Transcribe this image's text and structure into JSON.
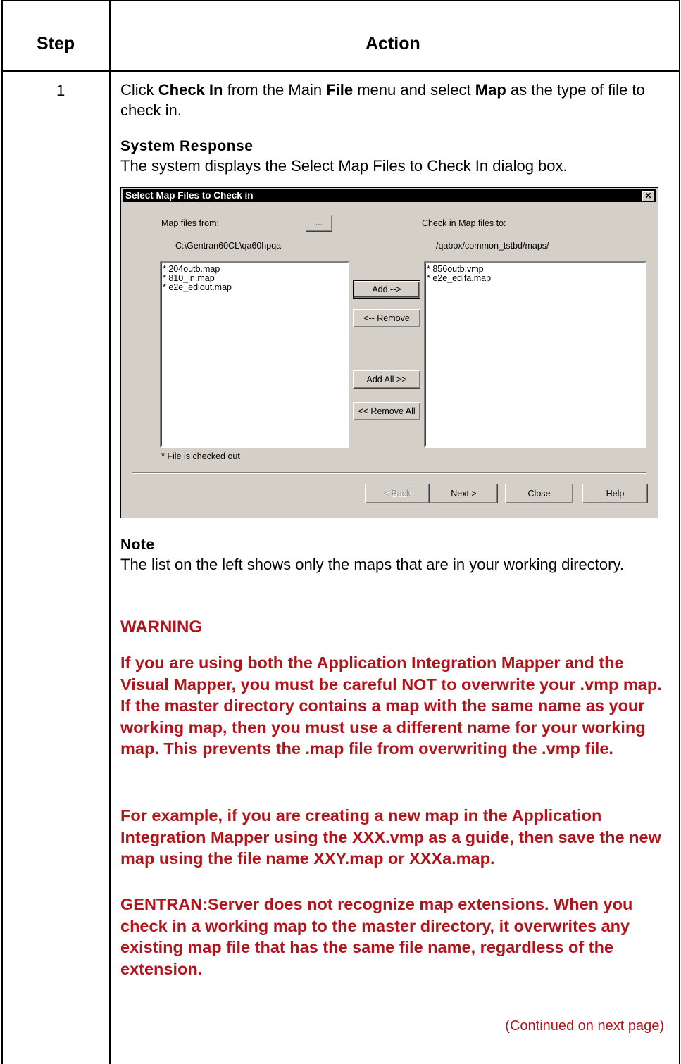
{
  "table": {
    "header_step": "Step",
    "header_action": "Action",
    "step_number": "1"
  },
  "instruction": {
    "t1": "Click ",
    "b1": "Check In",
    "t2": " from the Main ",
    "b2": "File",
    "t3": " menu and select ",
    "b3": "Map",
    "t4": " as the type of file to check in."
  },
  "system_response": {
    "heading": "System Response",
    "text": "The system displays the Select Map Files to Check In dialog box."
  },
  "dialog": {
    "title": "Select Map Files to Check in",
    "close_glyph": "✕",
    "from_label": "Map files from:",
    "browse_label": "...",
    "from_path": "C:\\Gentran60CL\\qa60hpqa",
    "to_label": "Check in Map files to:",
    "to_path": "/qabox/common_tstbd/maps/",
    "left_files": [
      "* 204outb.map",
      "* 810_in.map",
      "* e2e_ediout.map"
    ],
    "right_files": [
      "* 856outb.vmp",
      "* e2e_edifa.map"
    ],
    "add_label": "Add -->",
    "remove_label": "<-- Remove",
    "add_all_label": "Add All  >>",
    "remove_all_label": "<< Remove All",
    "footnote": "* File is checked out",
    "back_label": "< Back",
    "next_label": "Next >",
    "close_label": "Close",
    "help_label": "Help"
  },
  "note": {
    "heading": "Note",
    "text": "The list on the left shows only the maps that are in your working directory."
  },
  "warning": {
    "heading": "WARNING",
    "p1": "If you are using both the Application Integration Mapper and the Visual Mapper, you must be careful NOT to overwrite your .vmp map. If the master directory contains a map with the same name as your working map, then you must use a different name for your working map. This prevents the .map file from overwriting the .vmp file.",
    "p2": "For example, if you are creating a new map in the Application Integration Mapper using the XXX.vmp as a guide, then save the new map using the file name XXY.map or XXXa.map.",
    "p3": "GENTRAN:Server does not recognize map extensions. When you check in a working map to the master directory, it overwrites any existing map file that has the same file name, regardless of the extension."
  },
  "continued": "(Continued on next page)",
  "colors": {
    "warning": "#b3141b"
  }
}
